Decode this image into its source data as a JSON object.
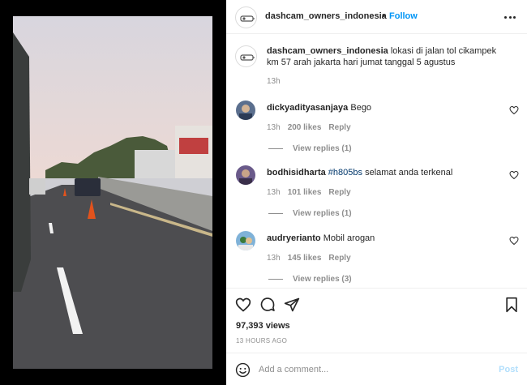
{
  "post": {
    "username": "dashcam_owners_indonesia",
    "dot": "•",
    "follow_label": "Follow",
    "more_icon": "more-options-icon",
    "caption": "lokasi di jalan tol cikampek km 57 arah jakarta hari jumat tanggal 5 agustus",
    "caption_time": "13h"
  },
  "comments": [
    {
      "username": "dickyadityasanjaya",
      "hashtag": "",
      "text": "Bego",
      "time": "13h",
      "likes": "200 likes",
      "reply": "Reply",
      "replies": "View replies (1)"
    },
    {
      "username": "bodhisidharta",
      "hashtag": "#h805bs",
      "text": "selamat anda terkenal",
      "time": "13h",
      "likes": "101 likes",
      "reply": "Reply",
      "replies": "View replies (1)"
    },
    {
      "username": "audryerianto",
      "hashtag": "",
      "text": "Mobil arogan",
      "time": "13h",
      "likes": "145 likes",
      "reply": "Reply",
      "replies": "View replies (3)"
    }
  ],
  "footer": {
    "views": "97,393 views",
    "time_ago": "13 HOURS AGO",
    "comment_placeholder": "Add a comment...",
    "post_label": "Post"
  },
  "colors": {
    "accent": "#0095f6",
    "hashtag": "#00376b",
    "muted": "#8e8e8e",
    "post_disabled": "#b2dffc"
  }
}
